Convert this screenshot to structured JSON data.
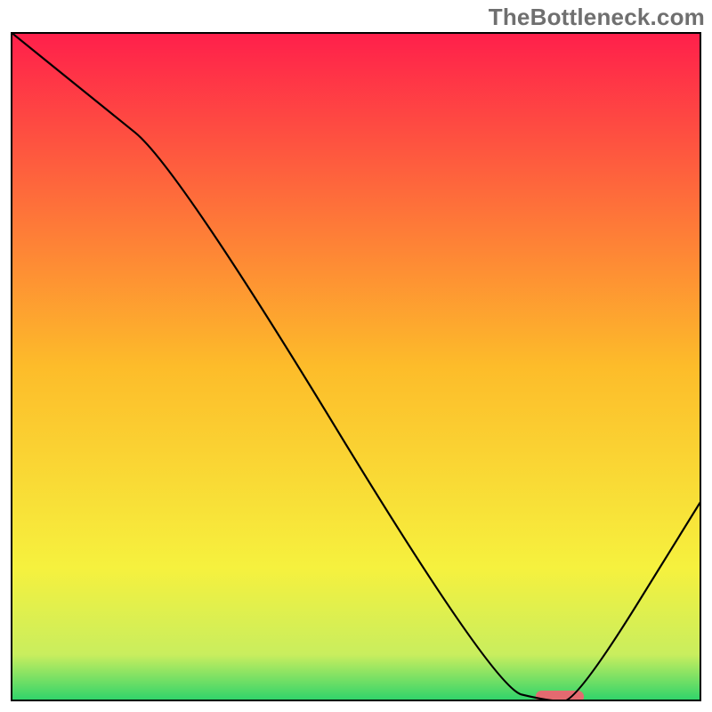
{
  "watermark": "TheBottleneck.com",
  "chart_data": {
    "type": "line",
    "title": "",
    "xlabel": "",
    "ylabel": "",
    "xlim": [
      0,
      100
    ],
    "ylim": [
      0,
      100
    ],
    "gradient_bands": [
      {
        "y": 0,
        "color": "#ff1f4b"
      },
      {
        "y": 50,
        "color": "#fdbc2a"
      },
      {
        "y": 80,
        "color": "#f6f13e"
      },
      {
        "y": 93,
        "color": "#c9ee5e"
      },
      {
        "y": 100,
        "color": "#2bd36b"
      }
    ],
    "series": [
      {
        "name": "curve",
        "x": [
          0,
          12,
          24,
          70,
          78,
          82,
          100
        ],
        "y": [
          100,
          90,
          80,
          2,
          0,
          0,
          30
        ],
        "stroke": "#000000",
        "stroke_width": 2.2
      }
    ],
    "marker": {
      "x_start": 76,
      "x_end": 83,
      "y": 0.7,
      "color": "#e46a70",
      "height": 1.8
    }
  }
}
